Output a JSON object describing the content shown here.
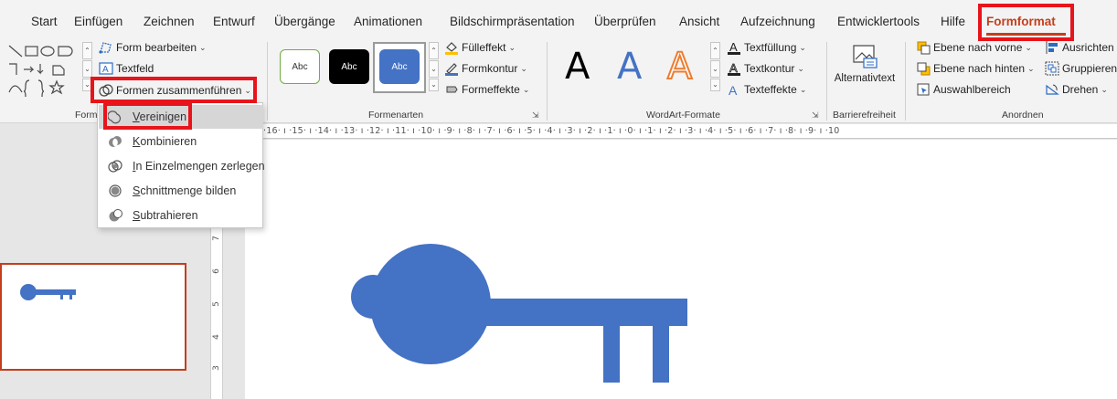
{
  "tabs": [
    "Start",
    "Einfügen",
    "Zeichnen",
    "Entwurf",
    "Übergänge",
    "Animationen",
    "Bildschirmpräsentation",
    "Überprüfen",
    "Ansicht",
    "Aufzeichnung",
    "Entwicklertools",
    "Hilfe",
    "Formformat"
  ],
  "active_tab": "Formformat",
  "ribbon": {
    "insert_shapes": {
      "edit_shape": "Form bearbeiten",
      "textbox": "Textfeld",
      "merge_shapes": "Formen zusammenführen",
      "group_label": "Form"
    },
    "shape_styles": {
      "samples": [
        "Abc",
        "Abc",
        "Abc"
      ],
      "fill": "Fülleffekt",
      "outline": "Formkontur",
      "effects": "Formeffekte",
      "group_label": "Formenarten"
    },
    "wordart": {
      "letters": [
        "A",
        "A",
        "A"
      ],
      "text_fill": "Textfüllung",
      "text_outline": "Textkontur",
      "text_effects": "Texteffekte",
      "group_label": "WordArt-Formate"
    },
    "accessibility": {
      "alt_text": "Alternativtext",
      "group_label": "Barrierefreiheit"
    },
    "arrange": {
      "bring_forward": "Ebene nach vorne",
      "send_backward": "Ebene nach hinten",
      "selection_pane": "Auswahlbereich",
      "align": "Ausrichten",
      "group": "Gruppieren",
      "rotate": "Drehen",
      "group_label": "Anordnen"
    }
  },
  "ruler_text": "·16· ı ·15· ı ·14· ı ·13· ı ·12· ı ·11· ı ·10· ı ·9· ı ·8· ı ·7· ı ·6· ı ·5· ı ·4· ı ·3· ı ·2· ı ·1· ı ·0· ı ·1· ı ·2· ı ·3· ı ·4· ı ·5· ı ·6· ı ·7· ı ·8· ı ·9· ı ·10",
  "vruler_numbers": [
    "7",
    "6",
    "5",
    "4",
    "3"
  ],
  "merge_menu": {
    "items": [
      {
        "pre": "",
        "accel": "V",
        "post": "ereinigen"
      },
      {
        "pre": "",
        "accel": "K",
        "post": "ombinieren"
      },
      {
        "pre": "",
        "accel": "I",
        "post": "n Einzelmengen zerlegen"
      },
      {
        "pre": "",
        "accel": "S",
        "post": "chnittmenge bilden"
      },
      {
        "pre": "",
        "accel": "S",
        "post": "ubtrahieren"
      }
    ]
  },
  "colors": {
    "accent": "#c43e1c",
    "highlight": "#e8141b",
    "shape_fill": "#4472c4"
  }
}
